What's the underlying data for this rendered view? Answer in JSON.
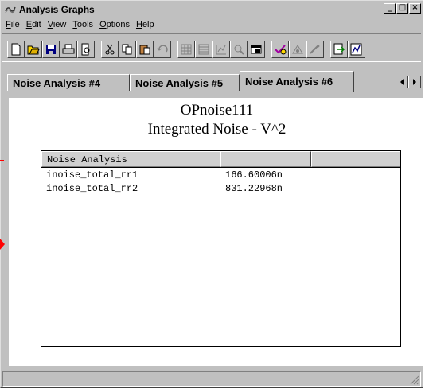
{
  "window": {
    "title": "Analysis Graphs",
    "controls": {
      "minimize": "_",
      "maximize": "□",
      "close": "×"
    }
  },
  "menu": [
    {
      "first": "F",
      "rest": "ile"
    },
    {
      "first": "E",
      "rest": "dit"
    },
    {
      "first": "V",
      "rest": "iew"
    },
    {
      "first": "T",
      "rest": "ools"
    },
    {
      "first": "O",
      "rest": "ptions"
    },
    {
      "first": "H",
      "rest": "elp"
    }
  ],
  "toolbar": {
    "icons": [
      "new-icon",
      "open-icon",
      "save-icon",
      "print-icon",
      "print-preview-icon",
      "cut-icon",
      "copy-icon",
      "paste-icon",
      "undo-icon",
      "grid-icon",
      "list-icon",
      "chart-icon",
      "zoom-icon",
      "window-icon",
      "check-icon",
      "analyze-icon",
      "wizard-icon",
      "export-icon",
      "report-icon"
    ]
  },
  "tabs": [
    {
      "label": "Noise Analysis #4",
      "active": false
    },
    {
      "label": "Noise Analysis #5",
      "active": false
    },
    {
      "label": "Noise Analysis #6",
      "active": true
    }
  ],
  "graph": {
    "title": "OPnoise111",
    "subtitle": "Integrated Noise - V^2"
  },
  "table": {
    "headers": [
      "Noise Analysis",
      "",
      ""
    ],
    "rows": [
      {
        "name": "inoise_total_rr1",
        "value": "166.60006n"
      },
      {
        "name": "inoise_total_rr2",
        "value": "831.22968n"
      }
    ]
  },
  "colors": {
    "chrome": "#c0c0c0",
    "page": "#ffffff",
    "marker": "#ff0000"
  }
}
